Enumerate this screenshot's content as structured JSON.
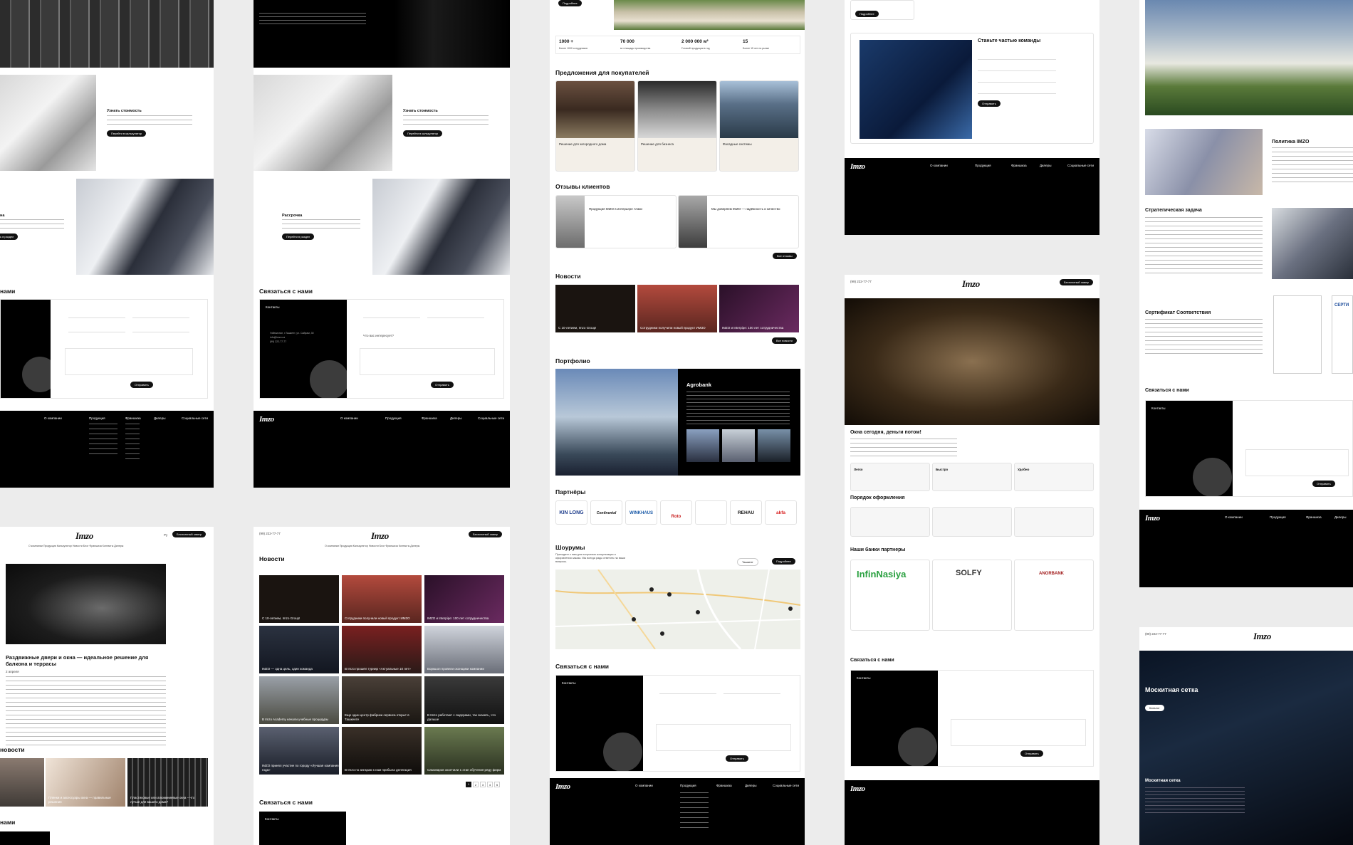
{
  "col1": {
    "card1_title": "Узнать стоимость",
    "card1_btn": "Перейти в калькулятор",
    "card2_title": "на",
    "card2_btn": "ь в раздел",
    "contact_title": "нами",
    "footer_company": "О компании",
    "footer_production": "Продукция",
    "footer_franchise": "Франшиза",
    "footer_dealers": "Дилеры",
    "footer_social": "Социальные сети",
    "lang": "Ру",
    "callback_btn": "Бесплатный замер",
    "nav": "О компании   Продукция   Калькулятор   Новости   Блог   Франшиза   Контакты   Дилеры",
    "article_title": "Раздвижные двери и окна — идеальное решение для балкона и террасы",
    "article_date": "2 апреля",
    "news_title": "новости",
    "news1": "Пленки и аксессуары окна — правильные решения",
    "news2": "Пластиковые или алюминиевые окна – что лучше для вашего дома?",
    "contact2_title": "нами"
  },
  "col2": {
    "card1_title": "Узнать стоимость",
    "card1_btn": "Перейти в калькулятор",
    "card2_title": "Рассрочка",
    "card2_btn": "Перейти в раздел",
    "contact_title": "Связаться с нами",
    "contacts": "Контакты",
    "address": "Узбекистан, г.Ташкент, ул. Сайрам, 30",
    "email": "info@imzo.uz",
    "phone": "(99) 222-77-77",
    "interest": "Что вас интересует?",
    "send_btn": "Отправить",
    "footer_company": "О компании",
    "footer_production": "Продукция",
    "footer_franchise": "Франшиза",
    "footer_dealers": "Дилеры",
    "footer_social": "Социальные сети",
    "phone_top": "(99) 222-77-77",
    "callback_btn": "Бесплатный замер",
    "nav": "О компании   Продукция   Калькулятор   Новости   Блог   Франшиза   Контакты   Дилеры",
    "news_title": "Новости",
    "news": [
      "С 10-летием, Imzo Group!",
      "Сотрудники получили новый продукт ИМЗО",
      "IMZO и Interpipe: 100 лет сотрудничества",
      "IMZO — одна цель, один команда",
      "В Imzo прошёл турнир «Актуальные 10 лет»",
      "Воркшоп провели оконщики компании",
      "В Imzo Academy начали учебные процедуры",
      "Еще один центр фабрики сервиса открыт в Ташкенте",
      "В Imzo работают с лидерами, так сказать, что дальше",
      "IMZO принял участие по городу «Лучшая компания года»",
      "В Imzo по ангарам к нам прибыла делегация",
      "Самоваров окончили 1 этап обучения ряду фирм"
    ],
    "pages": [
      "1",
      "2",
      "3",
      "4",
      "5"
    ],
    "contact2_title": "Связаться с нами",
    "contacts2": "Контакты"
  },
  "col3": {
    "stats": [
      {
        "value": "1000 +",
        "label": "Более 1000 сотрудников"
      },
      {
        "value": "70 000",
        "label": "м² площадь производства"
      },
      {
        "value": "2 000 000 м²",
        "label": "Готовой продукции в год"
      },
      {
        "value": "15",
        "label": "Более 15 лет на рынке"
      }
    ],
    "offers_title": "Предложения для покупателей",
    "offers": [
      {
        "title": "Решение для загородного дома"
      },
      {
        "title": "Решение для бизнеса"
      },
      {
        "title": "Фасадные системы"
      }
    ],
    "reviews_title": "Отзывы клиентов",
    "review1": "Продукция IMZO в интерьере Атаки",
    "review2": "Мы доверяем IMZO — надёжность и качество",
    "all_reviews": "Все отзывы",
    "news_title": "Новости",
    "news": [
      "С 10-летием, Imzo Group!",
      "Сотрудники получили новый продукт ИМЗО",
      "IMZO и Interpipe: 100 лет сотрудничества"
    ],
    "all_news": "Все новости",
    "portfolio_title": "Портфолио",
    "portfolio_name": "Agrobank",
    "partners_title": "Партнёры",
    "partners": [
      "KIN LONG",
      "Continental",
      "WINKHAUS",
      "Roto",
      "",
      "REHAU",
      "akfa"
    ],
    "showrooms_title": "Шоурумы",
    "showrooms_text": "Приходите к нам для получения консультации и оформления заказа. Мы всегда рады ответить на ваши вопросы.",
    "city_select": "Ташкент",
    "more_btn": "Подробнее",
    "contact_title": "Связаться с нами",
    "contacts": "Контакты",
    "send_btn": "Отправить",
    "footer_company": "О компании",
    "footer_production": "Продукция",
    "footer_franchise": "Франшиза",
    "footer_dealers": "Дилеры",
    "footer_social": "Социальные сети"
  },
  "col4": {
    "top_btn": "Подробнее",
    "team_title": "Станьте частью команды",
    "team_btn": "Отправить",
    "footer_company": "О компании",
    "footer_production": "Продукция",
    "footer_franchise": "Франшиза",
    "footer_dealers": "Дилеры",
    "footer_social": "Социальные сети",
    "phone_top": "(99) 222-77-77",
    "callback_btn": "Бесплатный замер",
    "hero_title": "Окна сегодня, деньги потом!",
    "benefits": [
      "Легко",
      "Быстро",
      "Удобно"
    ],
    "order_title": "Порядок оформления",
    "banks_title": "Наши банки партнеры",
    "banks": [
      "InfinNasiya",
      "SOLFY",
      "ANORBANK"
    ],
    "contact_title": "Связаться с нами",
    "contacts": "Контакты",
    "send_btn": "Отправить"
  },
  "col5": {
    "policy_title": "Политика IMZO",
    "strategy_title": "Стратегическая задача",
    "cert_title": "Сертификат Соответствия",
    "cert_side": "СЕРТИ",
    "contact_title": "Связаться с нами",
    "contacts": "Контакты",
    "send_btn": "Отправить",
    "footer_company": "О компании",
    "footer_production": "Продукция",
    "footer_franchise": "Франшиза",
    "footer_dealers": "Дилеры",
    "phone_top": "(99) 222-77-77",
    "net_title": "Москитная сетка",
    "net_btn": "Каталог",
    "net_title2": "Москитная сетка"
  },
  "logo": "Imzo"
}
